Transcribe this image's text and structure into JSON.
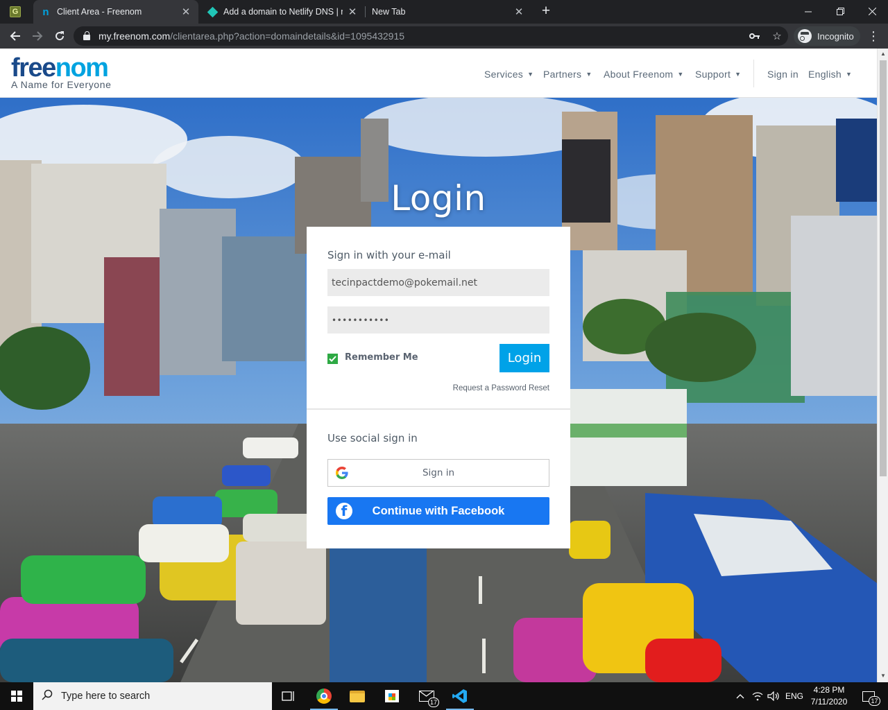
{
  "browser": {
    "tabs": [
      {
        "title": "",
        "favicon": "grammarly-icon"
      },
      {
        "title": "Client Area - Freenom",
        "favicon": "freenom-icon",
        "active": true
      },
      {
        "title": "Add a domain to Netlify DNS | m",
        "favicon": "netlify-icon"
      },
      {
        "title": "New Tab",
        "favicon": ""
      }
    ],
    "close_glyph": "✕",
    "new_tab_glyph": "+",
    "url_host": "my.freenom.com",
    "url_path": "/clientarea.php?action=domaindetails&id=1095432915",
    "incognito_label": "Incognito"
  },
  "site": {
    "logo_text_a": "free",
    "logo_text_b": "n",
    "logo_text_c": "o",
    "logo_text_d": "m",
    "tagline": "A Name for Everyone",
    "nav": [
      {
        "label": "Services"
      },
      {
        "label": "Partners"
      },
      {
        "label": "About Freenom"
      },
      {
        "label": "Support"
      },
      {
        "label": "Sign in"
      },
      {
        "label": "English"
      }
    ],
    "accent": "#00a2e8",
    "logo_dark": "#1a4a8a",
    "logo_light": "#00a3e0"
  },
  "login": {
    "heading": "Login",
    "email_section_title": "Sign in with your e-mail",
    "email_value": "tecinpactdemo@pokemail.net",
    "password_mask": "•••••••••••",
    "remember_label": "Remember Me",
    "remember_checked": true,
    "login_button": "Login",
    "reset_link": "Request a Password Reset",
    "social_section_title": "Use social sign in",
    "google_button": "Sign in",
    "facebook_button": "Continue with Facebook",
    "facebook_color": "#1877f2"
  },
  "taskbar": {
    "search_placeholder": "Type here to search",
    "mail_badge": "17",
    "lang": "ENG",
    "time": "4:28 PM",
    "date": "7/11/2020",
    "notification_count": "17"
  }
}
